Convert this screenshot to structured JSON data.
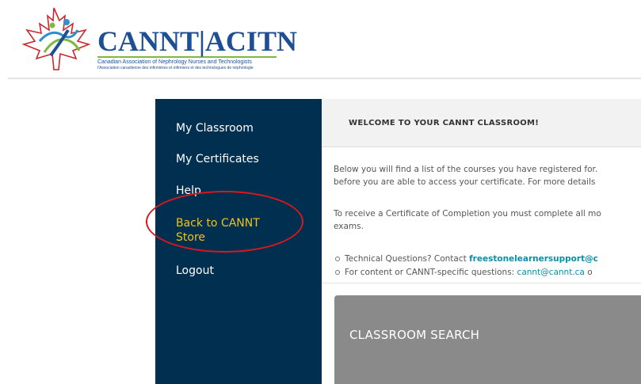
{
  "logo": {
    "main": "CANNT|ACITN",
    "sub_en": "Canadian Association of Nephrology Nurses and Technologists",
    "sub_fr": "l'Association canadienne des infirmières et infirmiers et des technologues de néphrologie"
  },
  "sidebar": {
    "items": [
      {
        "label": "My Classroom"
      },
      {
        "label": "My Certificates"
      },
      {
        "label": "Help"
      },
      {
        "label": "Back to CANNT Store"
      },
      {
        "label": "Logout"
      }
    ]
  },
  "main": {
    "title": "WELCOME TO YOUR CANNT CLASSROOM!",
    "para1_line1": "Below you will find a list of the courses you have registered for.",
    "para1_line2": "before you are able to access your certificate. For more details",
    "para2_line1": "To receive a Certificate of Completion you must complete all mo",
    "para2_line2": "exams.",
    "bullet1_prefix": "Technical Questions? Contact ",
    "bullet1_link": "freestonelearnersupport@c",
    "bullet2_prefix": "For content or CANNT-specific questions: ",
    "bullet2_link": "cannt@cannt.ca",
    "bullet2_suffix": " o",
    "search_label": "CLASSROOM SEARCH"
  },
  "colors": {
    "sidebar_bg": "#002f4f",
    "nav_highlight": "#f4c21c",
    "annotation_ring": "#d7191c",
    "link": "#0b8fa8",
    "search_bg": "#8a8a8a"
  }
}
